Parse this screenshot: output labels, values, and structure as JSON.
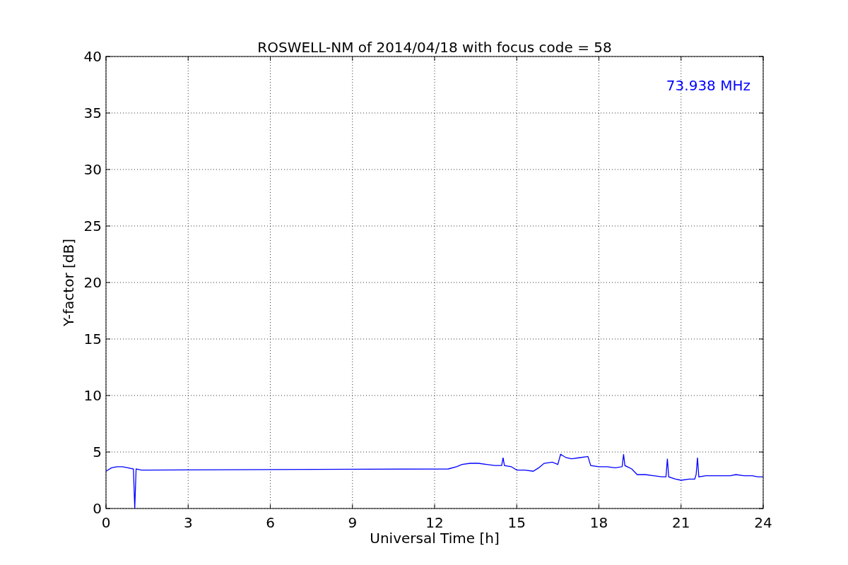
{
  "figure": {
    "chart_data": {
      "type": "line",
      "title": "ROSWELL-NM of 2014/04/18 with focus code = 58",
      "xlabel": "Universal Time [h]",
      "ylabel": "Y-factor [dB]",
      "x": [
        0,
        0.2,
        0.4,
        0.6,
        0.8,
        1.0,
        1.05,
        1.1,
        1.3,
        1.5,
        12.5,
        12.8,
        13.0,
        13.3,
        13.6,
        13.9,
        14.2,
        14.45,
        14.5,
        14.55,
        14.8,
        15.0,
        15.3,
        15.6,
        15.8,
        16.0,
        16.3,
        16.5,
        16.6,
        16.8,
        17.0,
        17.3,
        17.6,
        17.7,
        18.0,
        18.3,
        18.6,
        18.85,
        18.9,
        18.95,
        19.2,
        19.4,
        19.7,
        20.0,
        20.3,
        20.45,
        20.5,
        20.55,
        20.8,
        21.0,
        21.3,
        21.5,
        21.55,
        21.6,
        21.65,
        21.9,
        22.2,
        22.5,
        22.8,
        23.0,
        23.3,
        23.6,
        23.8,
        24.0
      ],
      "series": [
        {
          "name": "73.938 MHz",
          "color": "#0000ff",
          "values": [
            3.3,
            3.6,
            3.7,
            3.7,
            3.6,
            3.5,
            0,
            3.5,
            3.4,
            3.4,
            3.5,
            3.7,
            3.9,
            4.0,
            4.0,
            3.9,
            3.8,
            3.8,
            4.5,
            3.8,
            3.7,
            3.4,
            3.4,
            3.3,
            3.6,
            4.0,
            4.1,
            3.9,
            4.8,
            4.5,
            4.4,
            4.5,
            4.6,
            3.8,
            3.7,
            3.7,
            3.6,
            3.7,
            4.8,
            3.8,
            3.5,
            3.0,
            3.0,
            2.9,
            2.8,
            2.8,
            4.4,
            2.8,
            2.6,
            2.5,
            2.6,
            2.6,
            3.0,
            4.5,
            2.8,
            2.9,
            2.9,
            2.9,
            2.9,
            3.0,
            2.9,
            2.9,
            2.8,
            2.8
          ]
        }
      ],
      "xlim": [
        0,
        24
      ],
      "ylim": [
        0,
        40
      ],
      "xticks": [
        0,
        3,
        6,
        9,
        12,
        15,
        18,
        21,
        24
      ],
      "yticks": [
        0,
        5,
        10,
        15,
        20,
        25,
        30,
        35,
        40
      ],
      "grid": true
    }
  }
}
